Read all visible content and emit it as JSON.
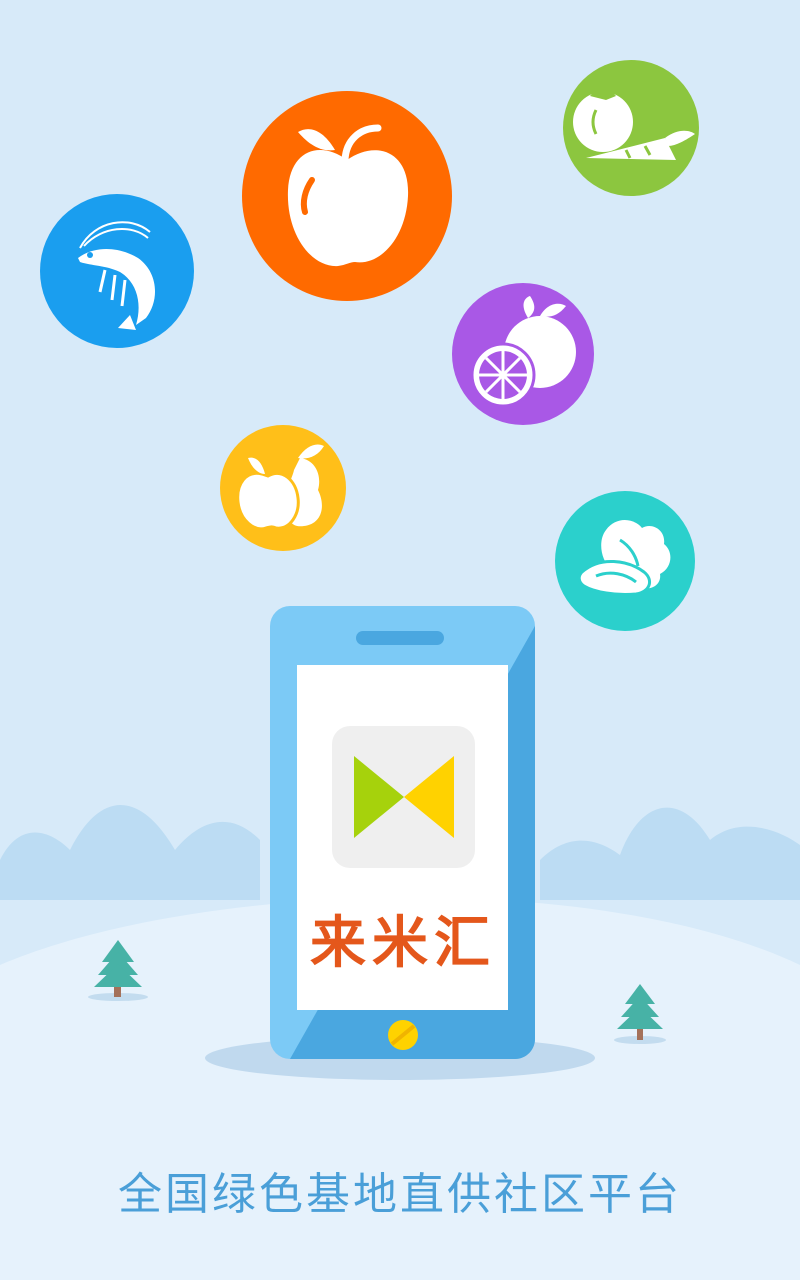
{
  "app": {
    "brand_name": "来米汇",
    "tagline": "全国绿色基地直供社区平台"
  },
  "icons": [
    {
      "name": "shrimp-icon",
      "color": "#1a9eef"
    },
    {
      "name": "apple-icon",
      "color": "#ff6a00"
    },
    {
      "name": "vegetables-icon",
      "color": "#8cc63f"
    },
    {
      "name": "orange-icon",
      "color": "#a958e6"
    },
    {
      "name": "fruits-icon",
      "color": "#ffbf19"
    },
    {
      "name": "cabbage-icon",
      "color": "#2bd0cc"
    }
  ],
  "colors": {
    "background": "#d7eaf9",
    "phone_body": "#7ccaf6",
    "logo_green": "#a6d20c",
    "logo_yellow": "#ffd200",
    "brand_text": "#e4571b",
    "tagline_text": "#4a9fd8"
  }
}
